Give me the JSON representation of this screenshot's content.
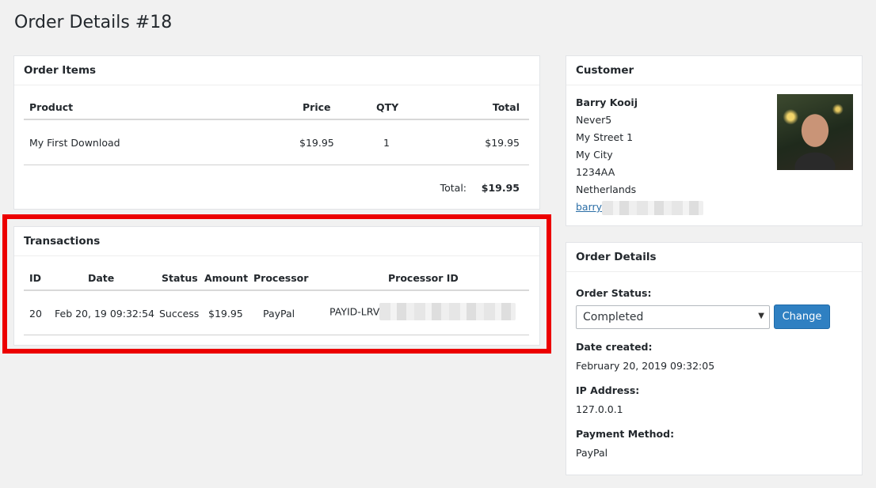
{
  "page": {
    "title": "Order Details #18"
  },
  "order_items": {
    "header": "Order Items",
    "columns": [
      "Product",
      "Price",
      "QTY",
      "Total"
    ],
    "rows": [
      {
        "product": "My First Download",
        "price": "$19.95",
        "qty": "1",
        "total": "$19.95"
      }
    ],
    "total_label": "Total:",
    "total_value": "$19.95"
  },
  "transactions": {
    "header": "Transactions",
    "columns": [
      "ID",
      "Date",
      "Status",
      "Amount",
      "Processor",
      "Processor ID"
    ],
    "rows": [
      {
        "id": "20",
        "date": "Feb 20, 19 09:32:54",
        "status": "Success",
        "amount": "$19.95",
        "processor": "PayPal",
        "processor_id": "PAYID-LRV"
      }
    ],
    "highlight_color": "#ec0000"
  },
  "customer": {
    "header": "Customer",
    "name": "Barry Kooij",
    "company": "Never5",
    "street": "My Street 1",
    "city": "My City",
    "postcode": "1234AA",
    "country": "Netherlands",
    "email": "barry"
  },
  "order_details": {
    "header": "Order Details",
    "status_label": "Order Status:",
    "status_value": "Completed",
    "change_label": "Change",
    "date_label": "Date created:",
    "date_value": "February 20, 2019 09:32:05",
    "ip_label": "IP Address:",
    "ip_value": "127.0.0.1",
    "payment_label": "Payment Method:",
    "payment_value": "PayPal"
  },
  "colors": {
    "accent": "#2f80c2",
    "link": "#2b6ea6",
    "background": "#f1f1f1"
  }
}
